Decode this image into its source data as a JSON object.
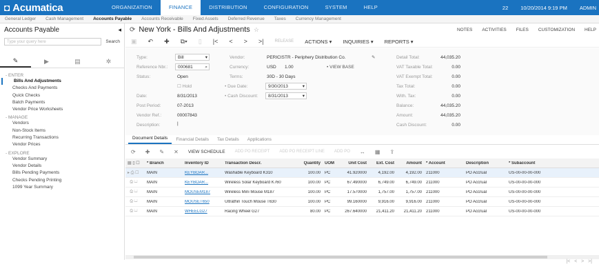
{
  "app": {
    "logo": "Acumatica",
    "modules": [
      "ORGANIZATION",
      "FINANCE",
      "DISTRIBUTION",
      "CONFIGURATION",
      "SYSTEM",
      "HELP"
    ],
    "active_module": "FINANCE",
    "badge": "22",
    "datetime": "10/20/2014 9:19 PM",
    "user": "ADMIN"
  },
  "subnav": [
    "General Ledger",
    "Cash Management",
    "Accounts Payable",
    "Accounts Receivable",
    "Fixed Assets",
    "Deferred Revenue",
    "Taxes",
    "Currency Management"
  ],
  "sidebar": {
    "title": "Accounts Payable",
    "search_placeholder": "Type your query here",
    "search_label": "Search",
    "groups": [
      {
        "label": "ENTER",
        "items": [
          "Bills And Adjustments",
          "Checks And Payments",
          "Quick Checks",
          "Batch Payments",
          "Vendor Price Worksheets"
        ]
      },
      {
        "label": "MANAGE",
        "items": [
          "Vendors",
          "Non-Stock Items",
          "Recurring Transactions",
          "Vendor Prices"
        ]
      },
      {
        "label": "EXPLORE",
        "items": [
          "Vendor Summary",
          "Vendor Details",
          "Bills Pending Payments",
          "Checks Pending Printing",
          "1099 Year Summary"
        ]
      }
    ],
    "active_item": "Bills And Adjustments"
  },
  "screen": {
    "title": "New York - Bills And Adjustments",
    "links": [
      "NOTES",
      "ACTIVITIES",
      "FILES",
      "CUSTOMIZATION",
      "HELP"
    ],
    "toolbar": {
      "release": "RELEASE",
      "actions": "ACTIONS",
      "inquiries": "INQUIRIES",
      "reports": "REPORTS"
    }
  },
  "form": {
    "type_label": "Type:",
    "type_value": "Bill",
    "ref_label": "Reference Nbr.:",
    "ref_value": "000681",
    "status_label": "Status:",
    "status_value": "Open",
    "hold_label": "Hold",
    "date_label": "Date:",
    "date_value": "8/31/2013",
    "postperiod_label": "Post Period:",
    "postperiod_value": "07-2013",
    "vendorref_label": "Vendor Ref.:",
    "vendorref_value": "00007843",
    "desc_label": "Description:",
    "desc_value": "",
    "vendor_label": "Vendor:",
    "vendor_value": "PERICISTR - Periphery Distribution Co.",
    "currency_label": "Currency:",
    "currency_value": "USD",
    "rate_value": "1.00",
    "viewbase": "VIEW BASE",
    "terms_label": "Terms:",
    "terms_value": "30D - 30 Days",
    "duedate_label": "Due Date:",
    "duedate_value": "9/30/2013",
    "cashdisc_label": "Cash Discount:",
    "cashdisc_value": "8/31/2013",
    "detailtotal_label": "Detail Total:",
    "detailtotal_value": "44,035.20",
    "vattaxable_label": "VAT Taxable Total:",
    "vattaxable_value": "0.00",
    "vatexempt_label": "VAT Exempt Total:",
    "vatexempt_value": "0.00",
    "taxtotal_label": "Tax Total:",
    "taxtotal_value": "0.00",
    "withtax_label": "With. Tax:",
    "withtax_value": "0.00",
    "balance_label": "Balance:",
    "balance_value": "44,035.20",
    "amount_label": "Amount:",
    "amount_value": "44,035.20",
    "cashdiscount_label": "Cash Discount:",
    "cashdiscount_value": "0.00"
  },
  "tabs": [
    "Document Details",
    "Financial Details",
    "Tax Details",
    "Applications"
  ],
  "gridbar": {
    "view_schedule": "VIEW SCHEDULE",
    "add_po_receipt": "ADD PO RECEIPT",
    "add_po_receipt_line": "ADD PO RECEIPT LINE",
    "add_po": "ADD PO"
  },
  "grid": {
    "columns": [
      "* Branch",
      "Inventory ID",
      "Transaction Descr.",
      "Quantity",
      "UOM",
      "Unit Cost",
      "Ext. Cost",
      "Amount",
      "* Account",
      "Description",
      "* Subaccount"
    ],
    "rows": [
      [
        "MAIN",
        "KEYBOAR...",
        "Washable Keyboard K310",
        "100.00",
        "PC",
        "41.920000",
        "4,192.00",
        "4,192.00",
        "211000",
        "PO Accrual",
        "US-00-00-00-000"
      ],
      [
        "MAIN",
        "KEYBOAR...",
        "Wireless Solar Keyboard K760",
        "100.00",
        "PC",
        "67.490000",
        "6,749.00",
        "6,749.00",
        "211000",
        "PO Accrual",
        "US-00-00-00-000"
      ],
      [
        "MAIN",
        "MOUSEM187",
        "Wireless Mini Mouse M187",
        "100.00",
        "PC",
        "17.570000",
        "1,757.00",
        "1,757.00",
        "211000",
        "PO Accrual",
        "US-00-00-00-000"
      ],
      [
        "MAIN",
        "MOUSET650",
        "Ultrathin Touch Mouse T630",
        "100.00",
        "PC",
        "99.160000",
        "9,916.00",
        "9,916.00",
        "211000",
        "PO Accrual",
        "US-00-00-00-000"
      ],
      [
        "MAIN",
        "WHEELG27",
        "Racing Wheel G27",
        "80.00",
        "PC",
        "267.640000",
        "21,411.20",
        "21,411.20",
        "211000",
        "PO Accrual",
        "US-00-00-00-000"
      ]
    ]
  }
}
